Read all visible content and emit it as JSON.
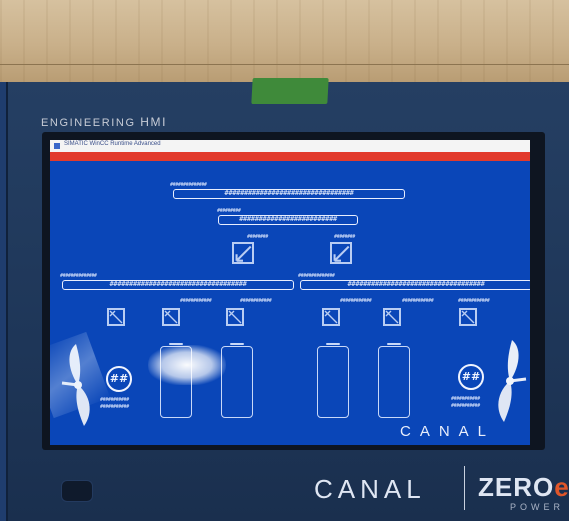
{
  "panel": {
    "brand": "ENGINEERING",
    "brand_bold": "HMI"
  },
  "window": {
    "title": "SIMATIC WinCC Runtime Advanced"
  },
  "screen": {
    "top_label": "##############",
    "top_bar": "#################################",
    "mid_label": "#########",
    "mid_bar": "#########################",
    "icon_labels": [
      "########",
      "########"
    ],
    "left_label": "##############",
    "left_bar": "###################################",
    "right_label": "##############",
    "right_bar": "###################################",
    "row_labels": [
      "############",
      "############",
      "############",
      "############",
      "############"
    ],
    "left_circle": "##",
    "right_circle": "##",
    "under_left": [
      "###########",
      "###########"
    ],
    "under_right": [
      "###########",
      "###########"
    ],
    "canal_watermark": "CANAL"
  },
  "footer": {
    "canal": "CANAL",
    "zero": "ZERO",
    "zero_accent": "e",
    "power": "POWER"
  },
  "colors": {
    "screen_bg": "#0a46b8",
    "red_bar": "#e23a2c",
    "panel": "#1f3d6e",
    "tape": "#3f8a3a"
  }
}
